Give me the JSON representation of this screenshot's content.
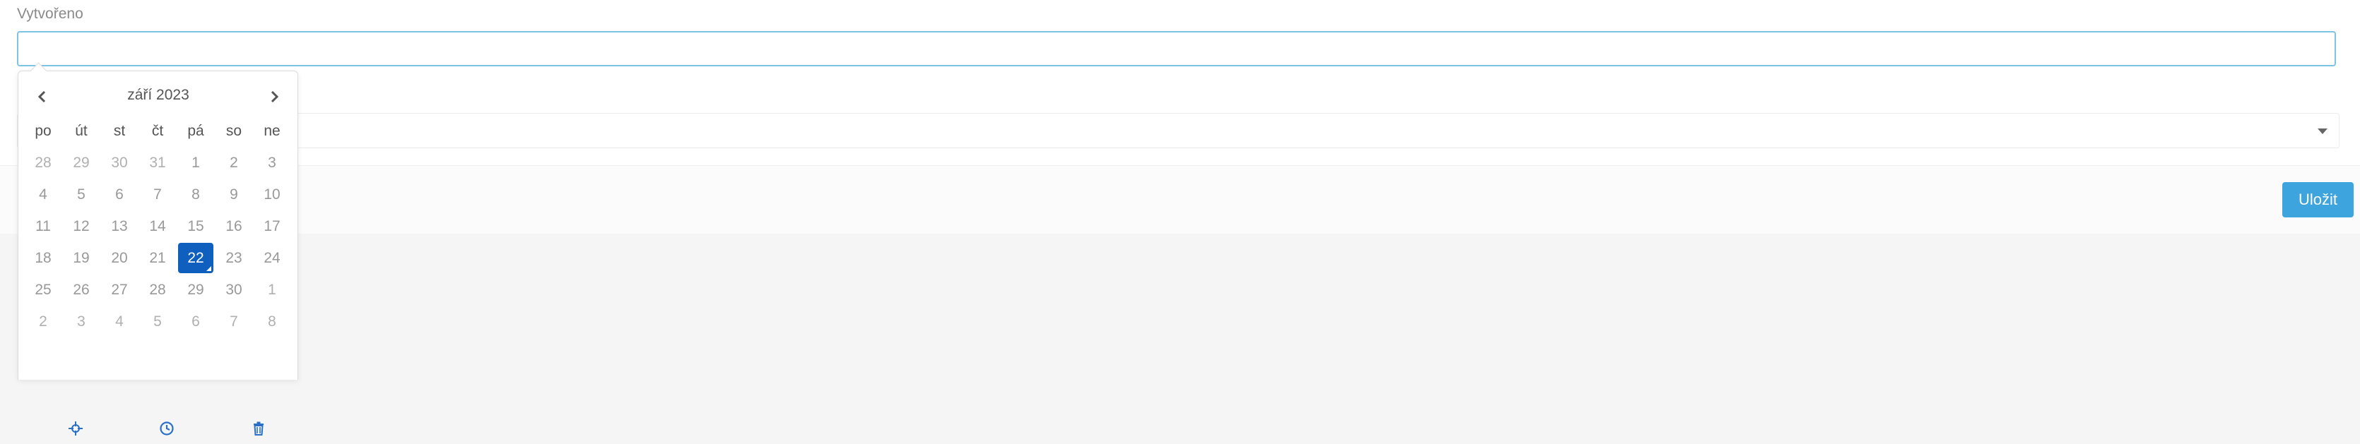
{
  "form": {
    "created_label": "Vytvořeno",
    "created_value": "",
    "save_label": "Uložit"
  },
  "datepicker": {
    "month_title": "září 2023",
    "weekdays": [
      "po",
      "út",
      "st",
      "čt",
      "pá",
      "so",
      "ne"
    ],
    "weeks": [
      [
        {
          "d": "28",
          "m": true
        },
        {
          "d": "29",
          "m": true
        },
        {
          "d": "30",
          "m": true
        },
        {
          "d": "31",
          "m": true
        },
        {
          "d": "1"
        },
        {
          "d": "2"
        },
        {
          "d": "3"
        }
      ],
      [
        {
          "d": "4"
        },
        {
          "d": "5"
        },
        {
          "d": "6"
        },
        {
          "d": "7"
        },
        {
          "d": "8"
        },
        {
          "d": "9"
        },
        {
          "d": "10"
        }
      ],
      [
        {
          "d": "11"
        },
        {
          "d": "12"
        },
        {
          "d": "13"
        },
        {
          "d": "14"
        },
        {
          "d": "15"
        },
        {
          "d": "16"
        },
        {
          "d": "17"
        }
      ],
      [
        {
          "d": "18"
        },
        {
          "d": "19"
        },
        {
          "d": "20"
        },
        {
          "d": "21"
        },
        {
          "d": "22",
          "sel": true
        },
        {
          "d": "23"
        },
        {
          "d": "24"
        }
      ],
      [
        {
          "d": "25"
        },
        {
          "d": "26"
        },
        {
          "d": "27"
        },
        {
          "d": "28"
        },
        {
          "d": "29"
        },
        {
          "d": "30"
        },
        {
          "d": "1",
          "m": true
        }
      ],
      [
        {
          "d": "2",
          "m": true
        },
        {
          "d": "3",
          "m": true
        },
        {
          "d": "4",
          "m": true
        },
        {
          "d": "5",
          "m": true
        },
        {
          "d": "6",
          "m": true
        },
        {
          "d": "7",
          "m": true
        },
        {
          "d": "8",
          "m": true
        }
      ]
    ],
    "icons": {
      "prev": "chevron-left-icon",
      "next": "chevron-right-icon",
      "actions": [
        "crosshair-icon",
        "clock-icon",
        "trash-icon"
      ]
    },
    "accent_color": "#0f5fbf"
  },
  "colors": {
    "save_button": "#3ea4dd",
    "input_focus_border": "#7fc3e4"
  }
}
